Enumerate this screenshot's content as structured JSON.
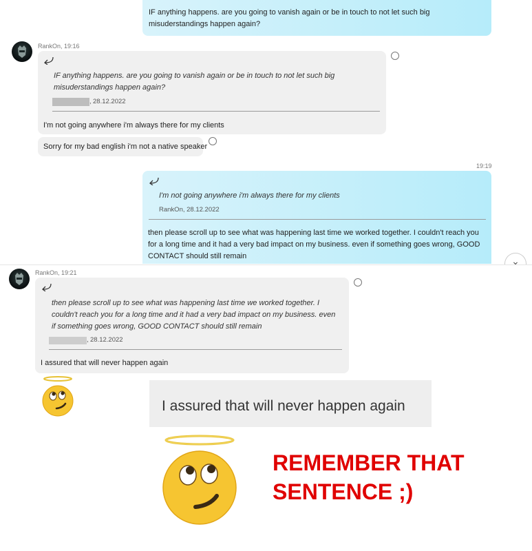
{
  "chat": {
    "msg1_text": "IF anything happens. are you going to vanish again or be in touch to not let such big misuderstandings happen again?",
    "msg2": {
      "sender_time": "RankOn, 19:16",
      "quote_text": "IF anything happens. are you going to vanish again or be in touch to not let such big misuderstandings happen again?",
      "quote_date": "28.12.2022",
      "text": "I'm not going anywhere i'm always there for my clients"
    },
    "msg3_text": "Sorry for my bad english i'm not a native speaker",
    "msg4": {
      "time": "19:19",
      "quote_text": "I'm not going anywhere i'm always there for my clients",
      "quote_author_date": "RankOn, 28.12.2022",
      "text": "then please scroll up to see what was happening last time we worked together. I couldn't reach you for a long time and it had a very bad impact on my business. even if something goes wrong, GOOD CONTACT should still remain"
    },
    "msg5": {
      "sender_time": "RankOn, 19:21",
      "quote_text": "then please scroll up to see what was happening last time we worked together. I couldn't reach you for a long time and it had a very bad impact on my business. even if something goes wrong, GOOD CONTACT should still remain",
      "quote_date": "28.12.2022",
      "text": "I assured that will never happen again"
    }
  },
  "overlay": {
    "zoomed_text": "I assured that will never happen again",
    "remember_line1": "REMEMBER THAT",
    "remember_line2": "SENTENCE ;)"
  },
  "icons": {
    "reply": "reply-arrow-icon",
    "emoji_reaction": "smiley-reaction-icon",
    "scroll_down": "chevron-down-icon",
    "halo_emoji": "innocent-halo-emoji"
  },
  "colors": {
    "outgoing_bubble": "#c4f0fb",
    "incoming_bubble": "#f0f0f0",
    "remember_text": "#e00000"
  }
}
